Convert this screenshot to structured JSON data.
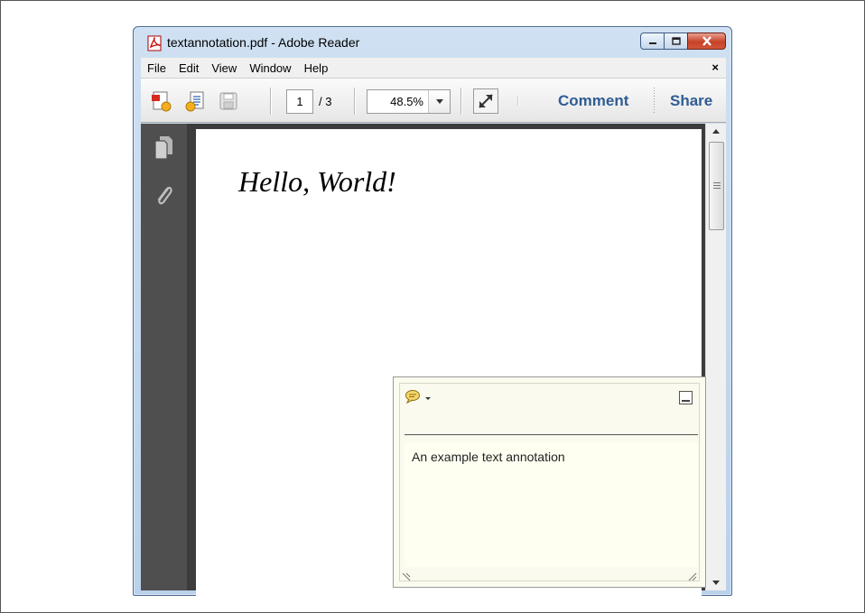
{
  "window": {
    "title": "textannotation.pdf - Adobe Reader",
    "caption_buttons": [
      "minimize",
      "maximize",
      "close"
    ]
  },
  "menubar": {
    "items": [
      "File",
      "Edit",
      "View",
      "Window",
      "Help"
    ],
    "close_glyph": "×"
  },
  "toolbar": {
    "icons": [
      "create-pdf-icon",
      "export-pdf-icon",
      "save-icon",
      "fullscreen-icon"
    ],
    "page_current": "1",
    "page_total": "/ 3",
    "zoom": "48.5%",
    "comment_label": "Comment",
    "share_label": "Share"
  },
  "sidebar": {
    "icons": [
      "pages-icon",
      "attachments-icon"
    ]
  },
  "document": {
    "text": "Hello, World!"
  },
  "note": {
    "text": "An example text annotation"
  },
  "colors": {
    "window_frame": "#b9d1ea",
    "link_blue": "#2f5c93",
    "close_red": "#c74228",
    "note_bg": "#fffff1"
  }
}
